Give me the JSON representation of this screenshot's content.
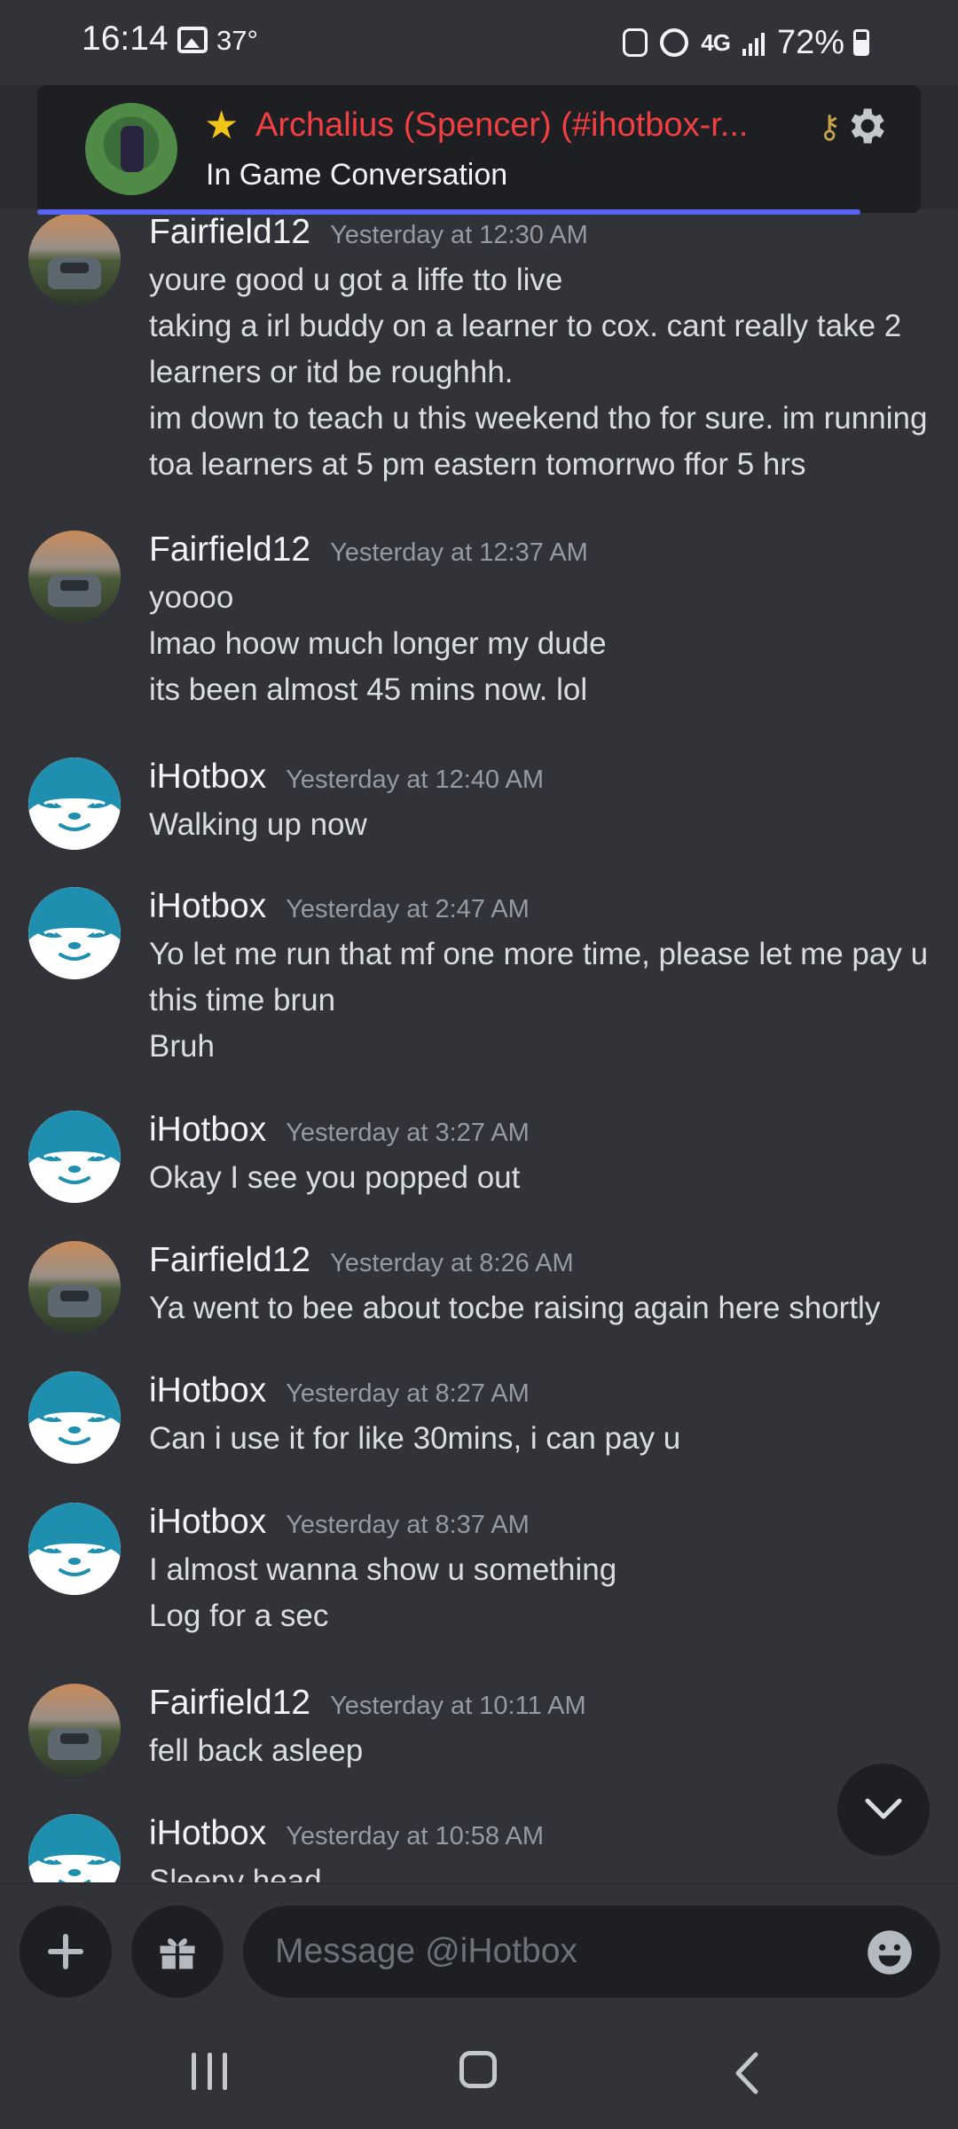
{
  "status_bar": {
    "time": "16:14",
    "temperature": "37°",
    "network": "4G",
    "battery": "72%"
  },
  "header": {
    "title": "Archalius (Spencer) (#ihotbox-r...",
    "subtitle": "In Game Conversation",
    "accent_color": "#f23f42",
    "progress_color": "#5865f2"
  },
  "messages": [
    {
      "author": "Fairfield12",
      "avatar": "car-avatar",
      "timestamp": "Yesterday at 12:30 AM",
      "lines": [
        "youre good u got a liffe tto live",
        "taking a irl buddy on a learner to cox. cant really take 2",
        "learners or itd be roughhh.",
        "im down to teach u this weekend tho for sure. im running",
        "toa learners at 5 pm eastern tomorrwo ffor 5 hrs"
      ]
    },
    {
      "author": "Fairfield12",
      "avatar": "car-avatar",
      "timestamp": "Yesterday at 12:37 AM",
      "lines": [
        "yoooo",
        "lmao hoow much longer my dude",
        "its been almost 45 mins now. lol"
      ]
    },
    {
      "author": "iHotbox",
      "avatar": "sloth-avatar",
      "timestamp": "Yesterday at 12:40 AM",
      "lines": [
        "Walking up now"
      ]
    },
    {
      "author": "iHotbox",
      "avatar": "sloth-avatar",
      "timestamp": "Yesterday at 2:47 AM",
      "lines": [
        "Yo let me run that mf one more time, please let me pay u",
        "this time brun",
        "Bruh"
      ]
    },
    {
      "author": "iHotbox",
      "avatar": "sloth-avatar",
      "timestamp": "Yesterday at 3:27 AM",
      "lines": [
        "Okay I see you popped out"
      ]
    },
    {
      "author": "Fairfield12",
      "avatar": "car-avatar",
      "timestamp": "Yesterday at 8:26 AM",
      "lines": [
        "Ya went to bee about tocbe raising again here shortly"
      ]
    },
    {
      "author": "iHotbox",
      "avatar": "sloth-avatar",
      "timestamp": "Yesterday at 8:27 AM",
      "lines": [
        "Can i use it for like 30mins, i can pay u"
      ]
    },
    {
      "author": "iHotbox",
      "avatar": "sloth-avatar",
      "timestamp": "Yesterday at 8:37 AM",
      "lines": [
        "I almost wanna show u something",
        "Log for a sec"
      ]
    },
    {
      "author": "Fairfield12",
      "avatar": "car-avatar",
      "timestamp": "Yesterday at 10:11 AM",
      "lines": [
        "fell back asleep"
      ]
    },
    {
      "author": "iHotbox",
      "avatar": "sloth-avatar",
      "timestamp": "Yesterday at 10:58 AM",
      "lines": [
        "Sleepy head"
      ]
    }
  ],
  "composer": {
    "placeholder": "Message @iHotbox"
  },
  "icons": {
    "add": "plus-icon",
    "gift": "gift-icon",
    "emoji": "emoji-icon",
    "jump": "chevron-down-icon",
    "settings": "gear-icon"
  }
}
